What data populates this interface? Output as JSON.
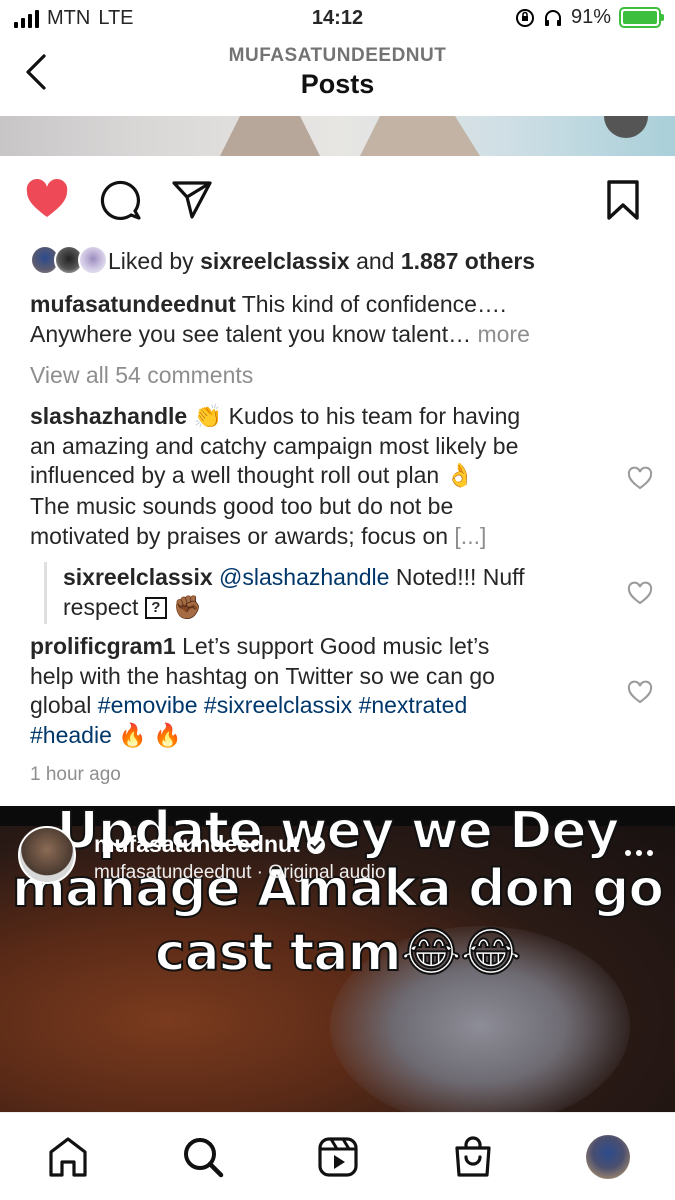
{
  "status_bar": {
    "carrier": "MTN",
    "network": "LTE",
    "time": "14:12",
    "battery": "91%"
  },
  "header": {
    "username": "MUFASATUNDEEDNUT",
    "title": "Posts"
  },
  "post": {
    "likes": {
      "prefix": "Liked by ",
      "user": "sixreelclassix",
      "middle": " and ",
      "others": "1.887 others"
    },
    "caption": {
      "user": "mufasatundeednut",
      "line1": " This kind of confidence….",
      "line2": "Anywhere you see talent you know  talent… ",
      "more": "more"
    },
    "view_comments": "View all 54 comments",
    "comments": [
      {
        "user": "slashazhandle",
        "emoji1": " 👏 ",
        "text1": "Kudos to his team for having",
        "line2": "an amazing and catchy campaign most likely be",
        "line3": "influenced by a well thought roll out plan ",
        "emoji2": "👌",
        "line4": "The music sounds good too but do not be",
        "line5": "motivated by praises or awards; focus on ",
        "ellipsis": "[...]"
      },
      {
        "user": "sixreelclassix",
        "mention": " @slashazhandle",
        "text1": " Noted!!! Nuff",
        "line2": "respect ",
        "box": "?",
        "emoji": " ✊🏾"
      },
      {
        "user": "prolificgram1",
        "text1": " Let’s support Good music let’s",
        "line2": "help with the hashtag on Twitter so we can go",
        "line3_prefix": "global ",
        "tags": [
          "#emovibe",
          "#sixreelclassix",
          "#nextrated",
          "#headie"
        ],
        "emoji": " 🔥 🔥"
      }
    ],
    "timestamp": "1 hour ago"
  },
  "reel": {
    "caption_lines": [
      "Update wey we Dey",
      "manage Amaka don go",
      "cast tam😂😂"
    ],
    "user": "mufasatundeednut",
    "audio": "mufasatundeednut · Original audio"
  },
  "colors": {
    "like_red": "#ed4956",
    "link_blue": "#00376b",
    "muted": "#8e8e8e",
    "battery_green": "#3cbf3c"
  },
  "icons": [
    "back-chevron-icon",
    "heart-filled-icon",
    "comment-icon",
    "share-icon",
    "bookmark-icon",
    "heart-outline-icon",
    "verified-icon",
    "more-icon",
    "home-icon",
    "search-icon",
    "reels-icon",
    "shop-icon",
    "profile-icon"
  ]
}
